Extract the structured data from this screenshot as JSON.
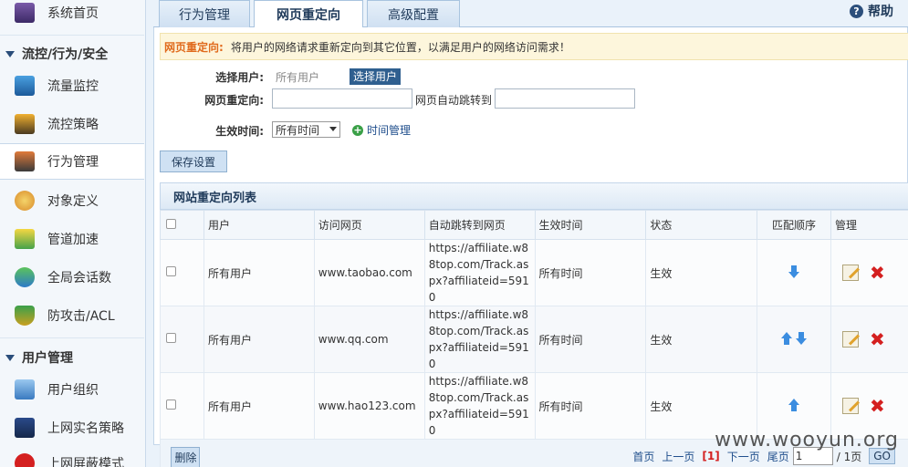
{
  "sidebar": {
    "items": [
      {
        "label": "系统首页",
        "icon": "monitor-icon"
      },
      {
        "label": "流量监控",
        "icon": "chart-icon"
      },
      {
        "label": "流控策略",
        "icon": "policy-icon"
      },
      {
        "label": "行为管理",
        "icon": "behavior-icon"
      },
      {
        "label": "对象定义",
        "icon": "palette-icon"
      },
      {
        "label": "管道加速",
        "icon": "lightning-icon"
      },
      {
        "label": "全局会话数",
        "icon": "chat-icon"
      },
      {
        "label": "防攻击/ACL",
        "icon": "shield-icon"
      },
      {
        "label": "用户组织",
        "icon": "users-icon"
      },
      {
        "label": "上网实名策略",
        "icon": "book-icon"
      },
      {
        "label": "上网屏蔽模式",
        "icon": "block-icon"
      }
    ],
    "sections": [
      "流控/行为/安全",
      "用户管理"
    ]
  },
  "tabs": [
    "行为管理",
    "网页重定向",
    "高级配置"
  ],
  "help_label": "帮助",
  "notice": {
    "tag": "网页重定向:",
    "text": "将用户的网络请求重新定向到其它位置，以满足用户的网络访问需求！"
  },
  "form": {
    "select_user_label": "选择用户:",
    "select_user_value": "所有用户",
    "select_user_button": "选择用户",
    "redirect_label": "网页重定向:",
    "redirect_value": "",
    "auto_jump_label": "网页自动跳转到",
    "auto_jump_value": "",
    "time_label": "生效时间:",
    "time_option": "所有时间",
    "time_manage_link": "时间管理",
    "save_button": "保存设置"
  },
  "list": {
    "title": "网站重定向列表",
    "columns": [
      "用户",
      "访问网页",
      "自动跳转到网页",
      "生效时间",
      "状态",
      "匹配顺序",
      "管理"
    ],
    "rows": [
      {
        "user": "所有用户",
        "page": "www.taobao.com",
        "target": "https://affiliate.w88top.com/Track.aspx?affiliateid=5910",
        "time": "所有时间",
        "status": "生效",
        "order": [
          "down"
        ]
      },
      {
        "user": "所有用户",
        "page": "www.qq.com",
        "target": "https://affiliate.w88top.com/Track.aspx?affiliateid=5910",
        "time": "所有时间",
        "status": "生效",
        "order": [
          "up",
          "down"
        ]
      },
      {
        "user": "所有用户",
        "page": "www.hao123.com",
        "target": "https://affiliate.w88top.com/Track.aspx?affiliateid=5910",
        "time": "所有时间",
        "status": "生效",
        "order": [
          "up"
        ]
      }
    ],
    "delete_button": "删除",
    "pager": {
      "first": "首页",
      "prev": "上一页",
      "current": "[1]",
      "next": "下一页",
      "last": "尾页",
      "page_value": "1",
      "total": "/ 1页",
      "go": "GO"
    }
  },
  "watermark": "www.wooyun.org"
}
